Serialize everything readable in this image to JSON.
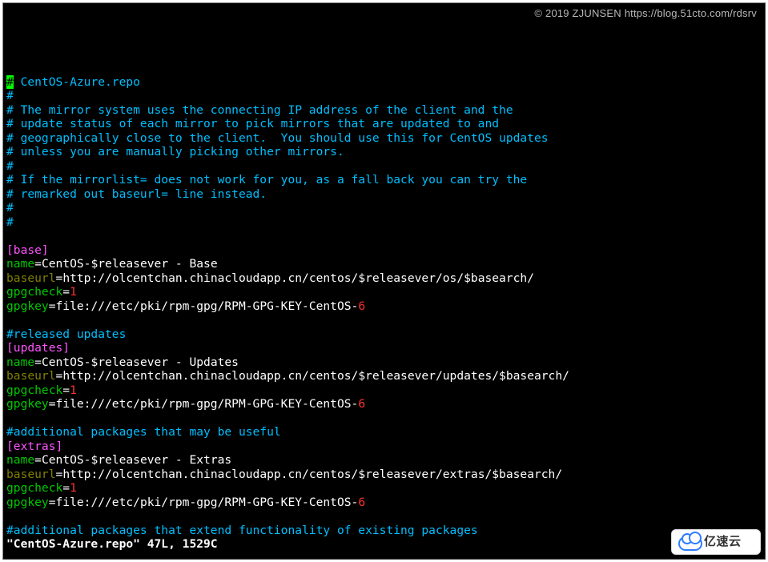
{
  "watermark": "© 2019 ZJUNSEN https://blog.51cto.com/rdsrv",
  "badge_text": "亿速云",
  "header": {
    "l1": " CentOS-Azure.repo",
    "l2": "#",
    "l3": "# The mirror system uses the connecting IP address of the client and the",
    "l4": "# update status of each mirror to pick mirrors that are updated to and",
    "l5": "# geographically close to the client.  You should use this for CentOS updates",
    "l6": "# unless you are manually picking other mirrors.",
    "l7": "#",
    "l8": "# If the mirrorlist= does not work for you, as a fall back you can try the",
    "l9": "# remarked out baseurl= line instead.",
    "l10": "#",
    "l11": "#"
  },
  "base": {
    "section": "[base]",
    "name_key": "name",
    "name_val": "CentOS-$releasever - Base",
    "baseurl_key": "baseurl",
    "baseurl_val": "http://olcentchan.chinacloudapp.cn/centos/$releasever/os/$basearch/",
    "gpgcheck_key": "gpgcheck",
    "gpgcheck_val": "1",
    "gpgkey_key": "gpgkey",
    "gpgkey_val": "file:///etc/pki/rpm-gpg/RPM-GPG-KEY-CentOS-",
    "gpgkey_num": "6"
  },
  "updates": {
    "comment": "#released updates",
    "section": "[updates]",
    "name_key": "name",
    "name_val": "CentOS-$releasever - Updates",
    "baseurl_key": "baseurl",
    "baseurl_val": "http://olcentchan.chinacloudapp.cn/centos/$releasever/updates/$basearch/",
    "gpgcheck_key": "gpgcheck",
    "gpgcheck_val": "1",
    "gpgkey_key": "gpgkey",
    "gpgkey_val": "file:///etc/pki/rpm-gpg/RPM-GPG-KEY-CentOS-",
    "gpgkey_num": "6"
  },
  "extras": {
    "comment": "#additional packages that may be useful",
    "section": "[extras]",
    "name_key": "name",
    "name_val": "CentOS-$releasever - Extras",
    "baseurl_key": "baseurl",
    "baseurl_val": "http://olcentchan.chinacloudapp.cn/centos/$releasever/extras/$basearch/",
    "gpgcheck_key": "gpgcheck",
    "gpgcheck_val": "1",
    "gpgkey_key": "gpgkey",
    "gpgkey_val": "file:///etc/pki/rpm-gpg/RPM-GPG-KEY-CentOS-",
    "gpgkey_num": "6"
  },
  "centosplus": {
    "comment": "#additional packages that extend functionality of existing packages"
  },
  "status": "\"CentOS-Azure.repo\" 47L, 1529C"
}
